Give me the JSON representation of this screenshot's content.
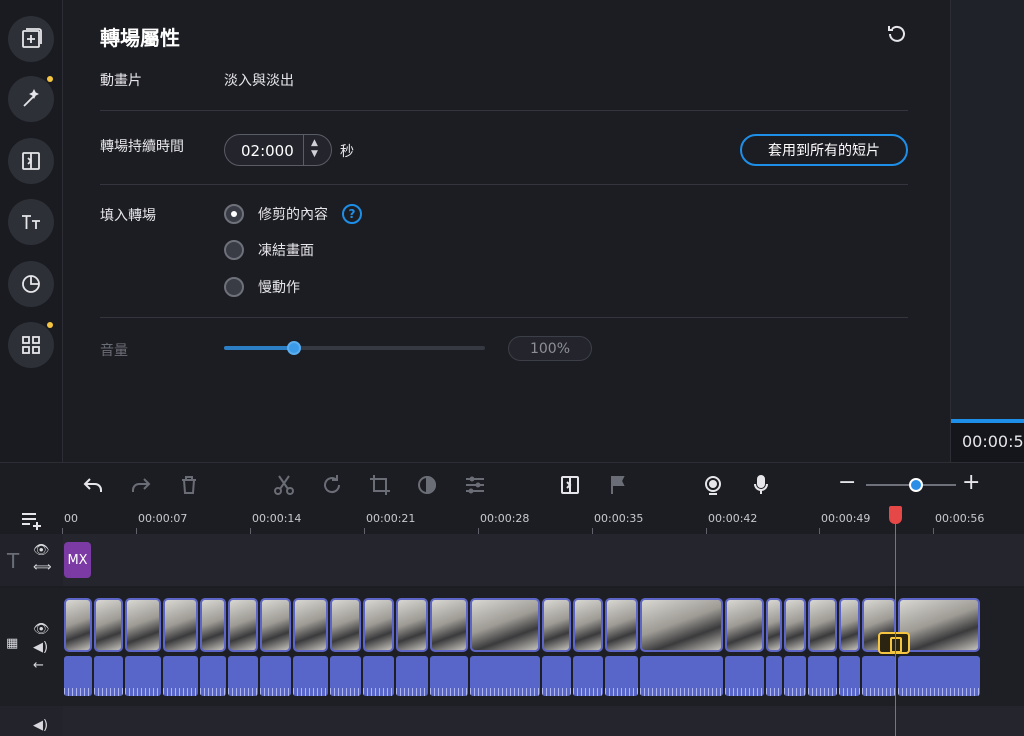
{
  "panel": {
    "title": "轉場屬性",
    "animation_label": "動畫片",
    "animation_value": "淡入與淡出",
    "duration_label": "轉場持續時間",
    "duration_value": "02:000",
    "duration_unit": "秒",
    "apply_all_label": "套用到所有的短片",
    "fill_label": "填入轉場",
    "fill_options": [
      {
        "label": "修剪的內容",
        "selected": true
      },
      {
        "label": "凍結畫面",
        "selected": false
      },
      {
        "label": "慢動作",
        "selected": false
      }
    ],
    "help_glyph": "?",
    "volume_label": "音量",
    "volume_value": "100%",
    "volume_slider_fraction": 0.27
  },
  "preview": {
    "timecode": "00:00:5"
  },
  "timeline": {
    "ruler_labels": [
      "00",
      "00:00:07",
      "00:00:14",
      "00:00:21",
      "00:00:28",
      "00:00:35",
      "00:00:42",
      "00:00:49",
      "00:00:56"
    ],
    "title_clip_label": "MX",
    "zoom_minus": "−",
    "zoom_plus": "+"
  },
  "colors": {
    "accent": "#1e8fe8",
    "playhead": "#e64848",
    "title_clip": "#7b3aa4",
    "video_border": "#5d66c7",
    "audio_wave": "#5866c9",
    "notify_dot": "#f5c542"
  },
  "icons": {
    "rail": [
      "add-media-icon",
      "magic-wand-icon",
      "transitions-icon",
      "titles-icon",
      "stickers-icon",
      "more-tools-icon"
    ],
    "toolbar": [
      "undo-icon",
      "redo-icon",
      "delete-icon",
      "cut-icon",
      "rotate-icon",
      "crop-icon",
      "color-adjust-icon",
      "clip-properties-icon",
      "transition-wizard-icon",
      "marker-flag-icon",
      "webcam-icon",
      "microphone-icon"
    ]
  }
}
